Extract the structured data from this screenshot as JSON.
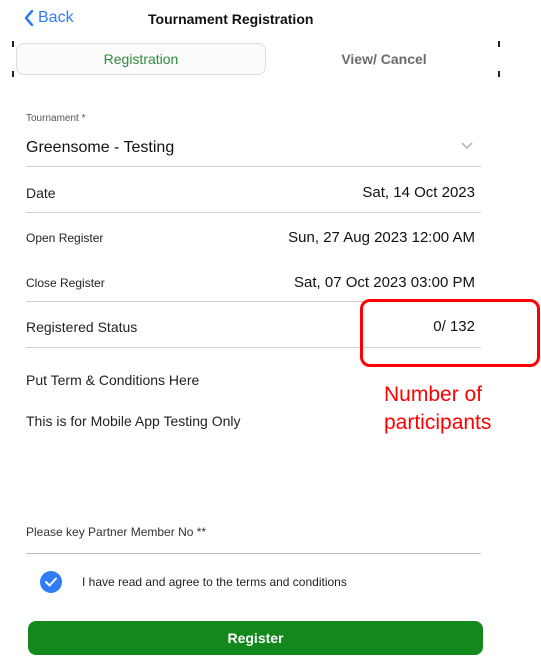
{
  "nav": {
    "back_label": "Back",
    "title": "Tournament Registration"
  },
  "tabs": [
    {
      "label": "Registration",
      "active": true
    },
    {
      "label": "View/ Cancel",
      "active": false
    }
  ],
  "form": {
    "tournament_label": "Tournament *",
    "tournament_value": "Greensome - Testing",
    "rows": {
      "date": {
        "label": "Date",
        "value": "Sat, 14 Oct 2023"
      },
      "open_register": {
        "label": "Open Register",
        "value": "Sun, 27 Aug 2023 12:00 AM"
      },
      "close_register": {
        "label": "Close Register",
        "value": "Sat, 07 Oct 2023 03:00 PM"
      },
      "registered_status": {
        "label": "Registered Status",
        "value": "0/ 132"
      }
    },
    "terms_line1": "Put Term & Conditions Here",
    "terms_line2": "This is for Mobile App Testing Only",
    "partner_placeholder": "Please key Partner Member No **",
    "agree_label": "I have read and agree to the terms and conditions",
    "agree_checked": true,
    "register_label": "Register"
  },
  "annotation": {
    "line1": "Number of",
    "line2": "participants"
  },
  "colors": {
    "accent_blue": "#2f7df6",
    "tab_green": "#2e8b3c",
    "button_green": "#12881d",
    "annotation_red": "#ff0000"
  },
  "icons": {
    "back": "chevron-left-icon",
    "dropdown": "chevron-down-icon",
    "check": "checkmark-icon"
  }
}
